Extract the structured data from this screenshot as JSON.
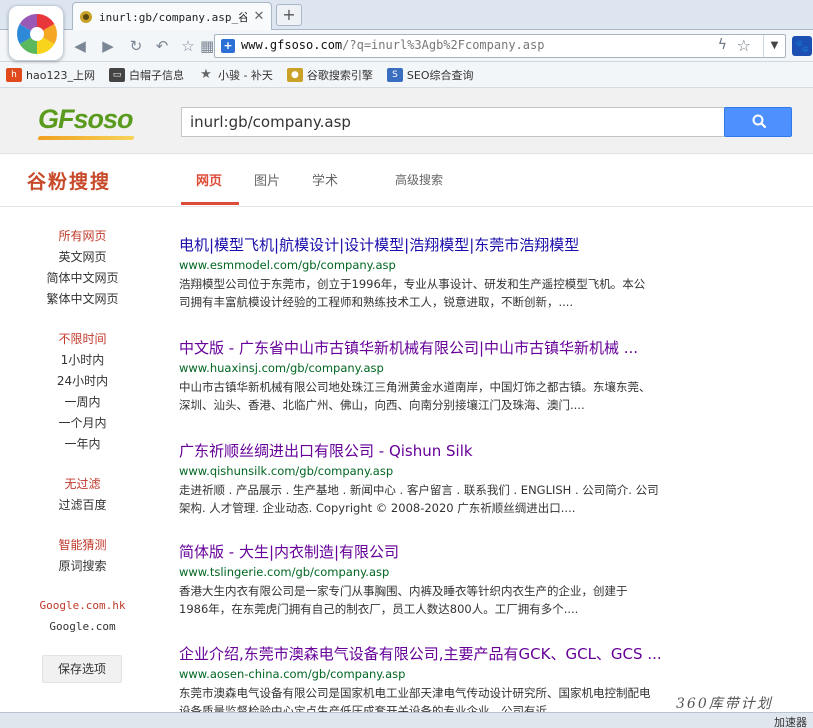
{
  "browser": {
    "tab_title": "inurl:gb/company.asp_谷粉",
    "url_host": "www.gfsoso.com",
    "url_rest": "/?q=inurl%3Agb%2Fcompany.asp",
    "bookmarks": [
      {
        "label": "hao123_上网",
        "icon": "hao123-icon"
      },
      {
        "label": "白帽子信息",
        "icon": "card-icon"
      },
      {
        "label": "小骏 - 补天",
        "icon": "star-icon"
      },
      {
        "label": "谷歌搜索引擎",
        "icon": "gfsoso-icon"
      },
      {
        "label": "SEO综合查询",
        "icon": "seo-icon"
      }
    ]
  },
  "search": {
    "logo_text": "GFsoso",
    "query": "inurl:gb/company.asp"
  },
  "subnav": {
    "brand": "谷粉搜搜",
    "tabs": [
      "网页",
      "图片",
      "学术"
    ],
    "advanced": "高级搜索"
  },
  "sidebar": {
    "all_pages": "所有网页",
    "english": "英文网页",
    "simplified": "简体中文网页",
    "traditional": "繁体中文网页",
    "any_time": "不限时间",
    "hour": "1小时内",
    "day": "24小时内",
    "week": "一周内",
    "month": "一个月内",
    "year": "一年内",
    "no_filter": "无过滤",
    "filter_baidu": "过滤百度",
    "smart_guess": "智能猜测",
    "original_search": "原词搜索",
    "google_hk": "Google.com.hk",
    "google_com": "Google.com",
    "save_options": "保存选项"
  },
  "results": [
    {
      "title": "电机|模型飞机|航模设计|设计模型|浩翔模型|东莞市浩翔模型",
      "url": "www.esmmodel.com/gb/company.asp",
      "line1": "浩翔模型公司位于东莞市，创立于1996年，专业从事设计、研发和生产遥控模型飞机。本公",
      "line2": "司拥有丰富航模设计经验的工程师和熟练技术工人，锐意进取，不断创新，...."
    },
    {
      "title": "中文版 - 广东省中山市古镇华新机械有限公司|中山市古镇华新机械 ...",
      "url": "www.huaxinsj.com/gb/company.asp",
      "line1": "中山市古镇华新机械有限公司地处珠江三角洲黄金水道南岸，中国灯饰之都古镇。东壤东莞、",
      "line2": "深圳、汕头、香港、北临广州、佛山，向西、向南分别接壤江门及珠海、澳门...."
    },
    {
      "title": "广东祈顺丝绸进出口有限公司 - Qishun Silk",
      "url": "www.qishunsilk.com/gb/company.asp",
      "line1": "走进祈顺 . 产品展示 . 生产基地 . 新闻中心 . 客户留言 . 联系我们 . ENGLISH . 公司简介. 公司",
      "line2": "架构. 人才管理. 企业动态. Copyright © 2008-2020 广东祈顺丝绸进出口...."
    },
    {
      "title": "简体版 - 大生|内衣制造|有限公司",
      "url": "www.tslingerie.com/gb/company.asp",
      "line1": "香港大生内衣有限公司是一家专门从事胸围、内裤及睡衣等针织内衣生产的企业，创建于",
      "line2": "1986年，在东莞虎门拥有自己的制衣厂，员工人数达800人。工厂拥有多个...."
    },
    {
      "title": "企业介绍,东莞市澳森电气设备有限公司,主要产品有GCK、GCL、GCS ...",
      "url": "www.aosen-china.com/gb/company.asp",
      "line1": "东莞市澳森电气设备有限公司是国家机电工业部天津电气传动设计研究所、国家机电控制配电",
      "line2": "设备质量监督检验中心定点生产低压成套开关设备的专业企业，公司有近...."
    }
  ],
  "status": {
    "watermark": "360库带计划",
    "accelerator": "加速器"
  }
}
